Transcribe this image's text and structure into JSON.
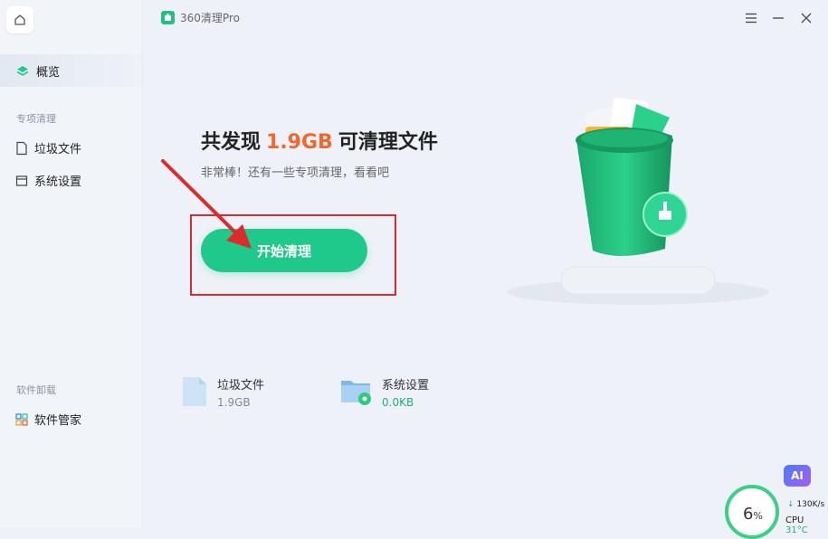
{
  "app": {
    "title": "360清理Pro"
  },
  "sidebar": {
    "overview_label": "概览",
    "section_special": "专项清理",
    "items": [
      {
        "label": "垃圾文件"
      },
      {
        "label": "系统设置"
      }
    ],
    "section_uninstall": "软件卸载",
    "software_manager_label": "软件管家"
  },
  "main": {
    "headline_prefix": "共发现",
    "headline_amount": "1.9GB",
    "headline_suffix": "可清理文件",
    "subline": "非常棒！还有一些专项清理，看看吧",
    "start_button": "开始清理"
  },
  "stats": [
    {
      "name": "垃圾文件",
      "value": "1.9GB",
      "value_color": "#888888"
    },
    {
      "name": "系统设置",
      "value": "0.0KB",
      "value_color": "#1fb36e"
    }
  ],
  "widgets": {
    "ai_label": "AI",
    "gauge_value": "6",
    "gauge_unit": "%",
    "net_speed": "130K/s",
    "cpu_label": "CPU",
    "cpu_value": "31°C"
  },
  "colors": {
    "accent": "#1fc98b",
    "highlight": "#f0692c",
    "annotation": "#dd2a2a"
  },
  "icons": {
    "home": "home-icon",
    "overview": "layers-icon",
    "junk": "document-icon",
    "settings": "window-icon",
    "software": "apps-grid-icon",
    "menu": "menu-icon",
    "minimize": "minimize-icon",
    "close": "close-icon"
  }
}
